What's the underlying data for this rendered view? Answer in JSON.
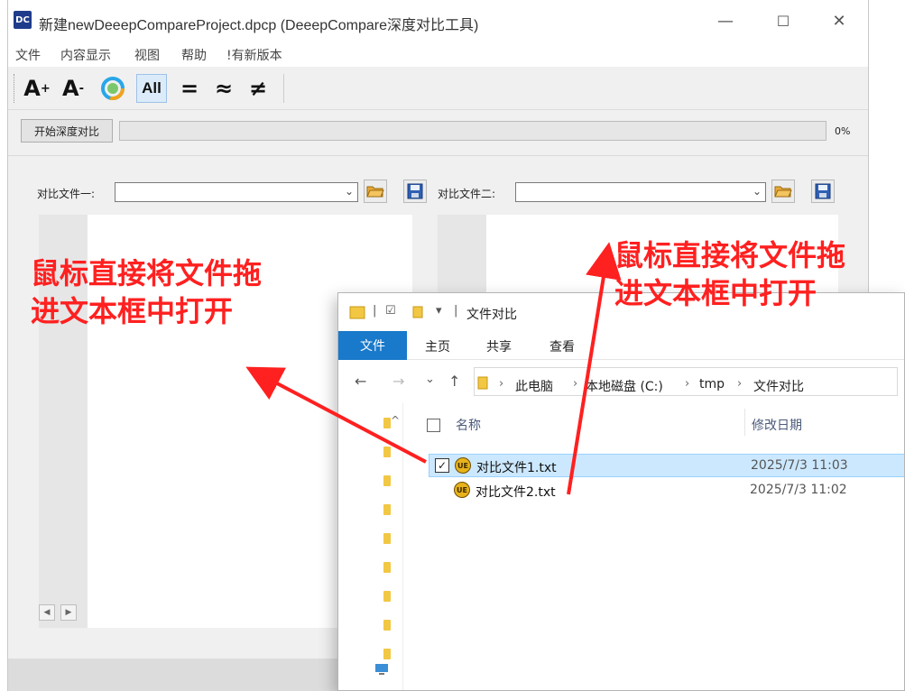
{
  "app": {
    "logo_text": "DC",
    "title": "新建newDeeepCompareProject.dpcp (DeeepCompare深度对比工具)",
    "window_controls": {
      "minimize": "—",
      "maximize": "☐",
      "close": "✕"
    },
    "menu": [
      "文件",
      "内容显示",
      "视图",
      "帮助",
      "!有新版本"
    ],
    "toolbar": {
      "font_increase": "A",
      "font_increase_sup": "+",
      "font_decrease": "A",
      "font_decrease_sup": "-",
      "all": "All",
      "equal": "=",
      "approx": "≈",
      "not_equal": "≠"
    },
    "start_button": "开始深度对比",
    "progress_percent": 0,
    "progress_label": "0%",
    "file1_label": "对比文件一:",
    "file2_label": "对比文件二:",
    "file1_value": "",
    "file2_value": ""
  },
  "explorer": {
    "title": "文件对比",
    "quick_access": [
      "|",
      "☑",
      "▾",
      "|"
    ],
    "ribbon": {
      "file": "文件",
      "home": "主页",
      "share": "共享",
      "view": "查看"
    },
    "nav": {
      "back": "←",
      "forward": "→",
      "recent": "⌄",
      "up": "↑"
    },
    "breadcrumb": [
      "此电脑",
      "本地磁盘 (C:)",
      "tmp",
      "文件对比"
    ],
    "columns": {
      "name": "名称",
      "modified": "修改日期"
    },
    "files": [
      {
        "icon": "UE",
        "name": "对比文件1.txt",
        "modified": "2025/7/3 11:03",
        "selected": true,
        "check": "✓"
      },
      {
        "icon": "UE",
        "name": "对比文件2.txt",
        "modified": "2025/7/3 11:02",
        "selected": false,
        "check": ""
      }
    ]
  },
  "annotations": {
    "left": [
      "鼠标直接将文件拖",
      "进文本框中打开"
    ],
    "right": [
      "鼠标直接将文件拖",
      "进文本框中打开"
    ],
    "color": "#ff2020"
  },
  "colors": {
    "ribbon_file_tab": "#1979ca",
    "selection": "#cce8ff",
    "progress_fill": "#06b025"
  }
}
